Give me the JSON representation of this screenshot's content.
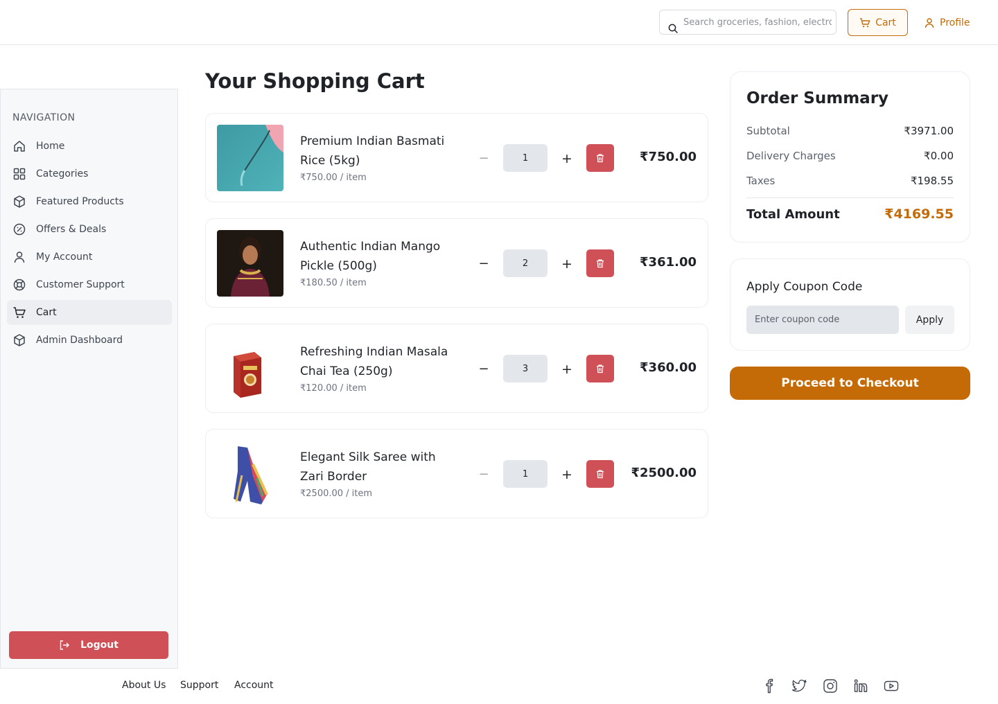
{
  "header": {
    "search_placeholder": "Search groceries, fashion, electronics...",
    "cart_label": "Cart",
    "profile_label": "Profile"
  },
  "sidebar": {
    "title": "NAVIGATION",
    "items": [
      {
        "label": "Home",
        "icon": "home-icon"
      },
      {
        "label": "Categories",
        "icon": "grid-icon"
      },
      {
        "label": "Featured Products",
        "icon": "box-icon"
      },
      {
        "label": "Offers & Deals",
        "icon": "percent-badge-icon"
      },
      {
        "label": "My Account",
        "icon": "user-icon"
      },
      {
        "label": "Customer Support",
        "icon": "lifebuoy-icon"
      },
      {
        "label": "Cart",
        "icon": "cart-icon",
        "active": true
      },
      {
        "label": "Admin Dashboard",
        "icon": "box-icon"
      }
    ],
    "logout_label": "Logout"
  },
  "cart": {
    "title": "Your Shopping Cart",
    "items": [
      {
        "name": "Premium Indian Basmati Rice (5kg)",
        "unit_price": "₹750.00 / item",
        "quantity": "1",
        "total": "₹750.00",
        "image": "basmati-rice-image"
      },
      {
        "name": "Authentic Indian Mango Pickle (500g)",
        "unit_price": "₹180.50 / item",
        "quantity": "2",
        "total": "₹361.00",
        "image": "mango-pickle-image"
      },
      {
        "name": "Refreshing Indian Masala Chai Tea (250g)",
        "unit_price": "₹120.00 / item",
        "quantity": "3",
        "total": "₹360.00",
        "image": "masala-chai-image"
      },
      {
        "name": "Elegant Silk Saree with Zari Border",
        "unit_price": "₹2500.00 / item",
        "quantity": "1",
        "total": "₹2500.00",
        "image": "silk-saree-image"
      }
    ]
  },
  "summary": {
    "title": "Order Summary",
    "subtotal_label": "Subtotal",
    "subtotal_value": "₹3971.00",
    "delivery_label": "Delivery Charges",
    "delivery_value": "₹0.00",
    "taxes_label": "Taxes",
    "taxes_value": "₹198.55",
    "total_label": "Total Amount",
    "total_value": "₹4169.55"
  },
  "coupon": {
    "title": "Apply Coupon Code",
    "placeholder": "Enter coupon code",
    "apply_label": "Apply"
  },
  "checkout_label": "Proceed to Checkout",
  "footer": {
    "links": [
      "About Us",
      "Support",
      "Account"
    ],
    "social": [
      "facebook-icon",
      "twitter-icon",
      "instagram-icon",
      "linkedin-icon",
      "youtube-icon"
    ]
  },
  "colors": {
    "accent": "#c46a06",
    "danger": "#cf5157",
    "qty_bg": "#e3e6ea"
  }
}
